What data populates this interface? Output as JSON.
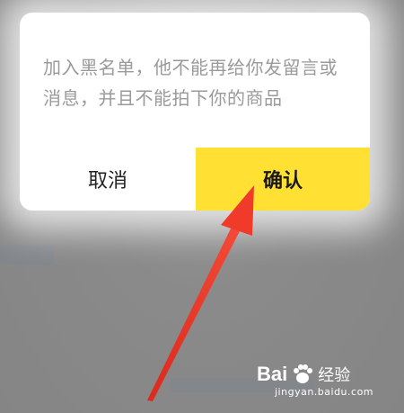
{
  "dialog": {
    "message": "加入黑名单，他不能再给你发留言或消息，并且不能拍下你的商品",
    "cancel_label": "取消",
    "confirm_label": "确认",
    "confirm_color": "#ffe033"
  },
  "annotation": {
    "arrow_color": "#f03a2a",
    "icon": "red-arrow-icon"
  },
  "watermark": {
    "brand_left": "Bai",
    "brand_right": "经验",
    "url": "jingyan.baidu.com"
  }
}
